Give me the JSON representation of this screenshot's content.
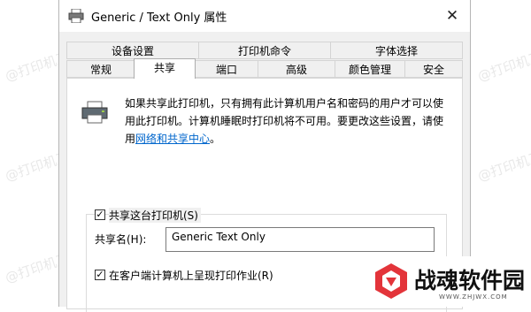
{
  "watermark": {
    "text": "@打印机卫士"
  },
  "window": {
    "title": "Generic / Text Only 属性",
    "close_glyph": "✕"
  },
  "tabs": {
    "row_top": [
      "设备设置",
      "打印机命令",
      "字体选择"
    ],
    "row_bottom": [
      "常规",
      "共享",
      "端口",
      "高级",
      "颜色管理",
      "安全"
    ],
    "selected": "共享"
  },
  "sharing": {
    "description_line1": "如果共享此打印机，只有拥有此计算机用户名和密码的用户才可以使",
    "description_line2": "用此打印机。计算机睡眠时打印机将不可用。要更改这些设置，请使",
    "description_prefix": "用",
    "description_link": "网络和共享中心",
    "description_suffix": "。",
    "share_checkbox_label": "共享这台打印机(S)",
    "share_checked": true,
    "share_name_label": "共享名(H):",
    "share_name_value": "Generic  Text Only",
    "render_checkbox_label": "在客户端计算机上呈现打印作业(R)",
    "render_checked": true
  },
  "brand": {
    "name": "战魂软件园",
    "url": "WWW.ZHJWX.COM",
    "accent_color": "#e3343a"
  }
}
